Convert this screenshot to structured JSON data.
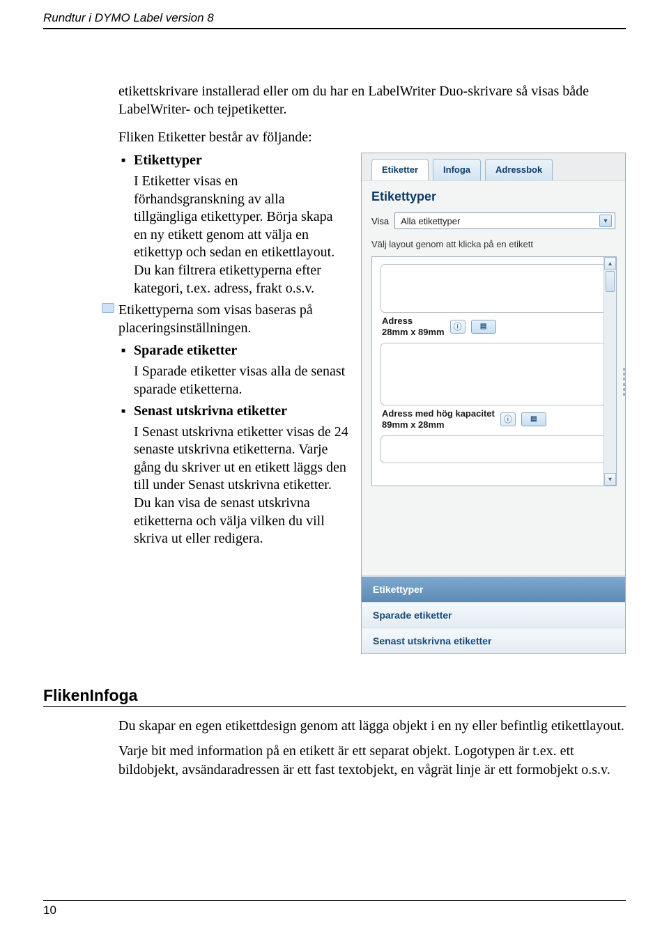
{
  "header": {
    "title": "Rundtur i DYMO Label version 8"
  },
  "intro": "etikettskrivare installerad eller om du har en LabelWriter Duo-skrivare så visas både LabelWriter- och tejpetiketter.",
  "subintro": "Fliken Etiketter består av följande:",
  "bullets": [
    {
      "title": "Etikettyper",
      "body": "I Etiketter visas en förhandsgranskning av alla tillgängliga etikettyper. Börja skapa en ny etikett genom att välja en etikettyp och sedan en etikettlayout. Du kan filtrera etikettyperna efter kategori, t.ex. adress, frakt o.s.v.",
      "note": "Etikettyperna som visas baseras på placeringsinställningen."
    },
    {
      "title": "Sparade etiketter",
      "body": "I Sparade etiketter visas alla de senast sparade etiketterna."
    },
    {
      "title": "Senast utskrivna etiketter",
      "body": "I Senast utskrivna etiketter visas de 24 senaste utskrivna etiketterna. Varje gång du skriver ut en etikett läggs den till under Senast utskrivna etiketter. Du kan visa de senast utskrivna etiketterna och välja vilken du vill skriva ut eller redigera."
    }
  ],
  "panel": {
    "tabs": [
      "Etiketter",
      "Infoga",
      "Adressbok"
    ],
    "heading": "Etikettyper",
    "visa_label": "Visa",
    "visa_value": "Alla etikettyper",
    "hint": "Välj layout genom att klicka på en etikett",
    "cards": [
      {
        "line1": "Adress",
        "line2": "28mm x 89mm"
      },
      {
        "line1": "Adress med hög kapacitet",
        "line2": "89mm x 28mm"
      }
    ],
    "accordion": [
      "Etikettyper",
      "Sparade etiketter",
      "Senast utskrivna etiketter"
    ]
  },
  "section2": {
    "title": "FlikenInfoga",
    "p1": "Du skapar en egen etikettdesign genom att lägga objekt i en ny eller befintlig etikettlayout.",
    "p2": "Varje bit med information på en etikett är ett separat objekt. Logotypen är t.ex. ett bildobjekt, avsändaradressen är ett fast textobjekt, en vågrät linje är ett formobjekt o.s.v."
  },
  "footer": {
    "page": "10"
  }
}
